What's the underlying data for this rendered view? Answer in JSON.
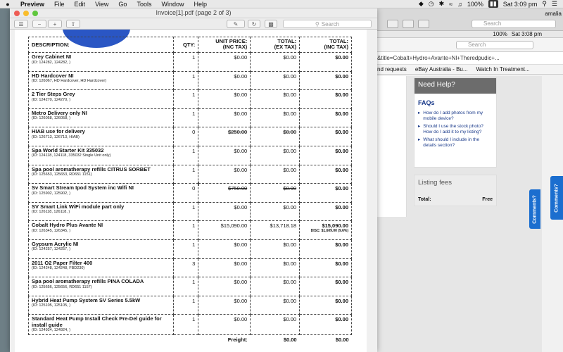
{
  "menubar": {
    "app": "Preview",
    "items": [
      "File",
      "Edit",
      "View",
      "Go",
      "Tools",
      "Window",
      "Help"
    ],
    "battery": "100%",
    "clock": "Sat 3:09 pm",
    "user": "amalia"
  },
  "preview": {
    "title": "Invoice[1].pdf (page 2 of 3)",
    "search_placeholder": "Search"
  },
  "browser": {
    "search_placeholder": "Search",
    "inner_battery": "100%",
    "inner_clock": "Sat 3:08 pm",
    "inner_user": "amalia",
    "url": "&title=Cobalt+Hydro+Avante+Nl+Theredpudic+...",
    "bookmarks": [
      "nd requests",
      "eBay Australia - Bu...",
      "Watch In Treatment..."
    ],
    "help": {
      "title": "Need Help?",
      "faqs_title": "FAQs",
      "questions": [
        "How do I add photos from my mobile device?",
        "Should I use the stock photo? How do I add it to my listing?",
        "What should I include in the details section?"
      ]
    },
    "fees": {
      "title": "Listing fees",
      "total_label": "Total:",
      "total_value": "Free"
    },
    "comments_label": "Comments?"
  },
  "invoice": {
    "headers": {
      "desc": "DESCRIPTION:",
      "qty": "QTY:",
      "unit_price": "UNIT PRICE:",
      "unit_price_sub": "(INC TAX)",
      "total_ex": "TOTAL:",
      "total_ex_sub": "(EX TAX)",
      "total_inc": "TOTAL:",
      "total_inc_sub": "(INC TAX)"
    },
    "rows": [
      {
        "name": "Grey Cabinet NI",
        "id": "(ID: 124282, 124282, )",
        "qty": "1",
        "unit": "$0.00",
        "ex": "$0.00",
        "inc": "$0.00",
        "strike": false,
        "disc": ""
      },
      {
        "name": "HD Hardcover NI",
        "id": "(ID: 126067, HD Hardcover, HD Hardcover)",
        "qty": "1",
        "unit": "$0.00",
        "ex": "$0.00",
        "inc": "$0.00",
        "strike": false,
        "disc": ""
      },
      {
        "name": "2 Tier Steps Grey",
        "id": "(ID: 124270, 124270, )",
        "qty": "1",
        "unit": "$0.00",
        "ex": "$0.00",
        "inc": "$0.00",
        "strike": false,
        "disc": ""
      },
      {
        "name": "Metro Delivery only NI",
        "id": "(ID: 126058, 126058, )",
        "qty": "1",
        "unit": "$0.00",
        "ex": "$0.00",
        "inc": "$0.00",
        "strike": false,
        "disc": ""
      },
      {
        "name": "HIAB use for delivery",
        "id": "(ID: 126713, 126713, HIAB)",
        "qty": "0",
        "unit": "$250.00",
        "ex": "$0.00",
        "inc": "$0.00",
        "strike": true,
        "disc": ""
      },
      {
        "name": "Spa World Starter Kit 335032",
        "id": "(ID: 124118, 124118, 335032 Single Unit only)",
        "qty": "1",
        "unit": "$0.00",
        "ex": "$0.00",
        "inc": "$0.00",
        "strike": false,
        "disc": ""
      },
      {
        "name": "Spa pool aromatherapy refills CITRUS SORBET",
        "id": "(ID: 125653, 125653, RD651 1151)",
        "qty": "1",
        "unit": "$0.00",
        "ex": "$0.00",
        "inc": "$0.00",
        "strike": false,
        "disc": ""
      },
      {
        "name": "Sv Smart Stream Ipod System inc Wifi NI",
        "id": "(ID: 125902, 125902, )",
        "qty": "0",
        "unit": "$750.00",
        "ex": "$0.00",
        "inc": "$0.00",
        "strike": true,
        "disc": ""
      },
      {
        "name": "SV Smart Link WiFi module part only",
        "id": "(ID: 126118, 126118, )",
        "qty": "1",
        "unit": "$0.00",
        "ex": "$0.00",
        "inc": "$0.00",
        "strike": false,
        "disc": ""
      },
      {
        "name": "Cobalt Hydro Plus Avante NI",
        "id": "(ID: 126345, 126345, )",
        "qty": "1",
        "unit": "$15,090.00",
        "ex": "$13,718.18",
        "inc": "$15,090.00",
        "strike": false,
        "disc": "DISC: $1,609.00 (9.6%)"
      },
      {
        "name": "Gypsum Acrylic NI",
        "id": "(ID: 124257, 124257, )",
        "qty": "1",
        "unit": "$0.00",
        "ex": "$0.00",
        "inc": "$0.00",
        "strike": false,
        "disc": ""
      },
      {
        "name": "2011 O2 Paper Filter 400",
        "id": "(ID: 124248, 124248, FBD230)",
        "qty": "3",
        "unit": "$0.00",
        "ex": "$0.00",
        "inc": "$0.00",
        "strike": false,
        "disc": ""
      },
      {
        "name": "Spa pool aromatherapy refills PINA COLADA",
        "id": "(ID: 125656, 125656, RD651 1157)",
        "qty": "1",
        "unit": "$0.00",
        "ex": "$0.00",
        "inc": "$0.00",
        "strike": false,
        "disc": ""
      },
      {
        "name": "Hybrid Heat Pump System SV Series 5.5kW",
        "id": "(ID: 125105, 125105, )",
        "qty": "1",
        "unit": "$0.00",
        "ex": "$0.00",
        "inc": "$0.00",
        "strike": false,
        "disc": ""
      },
      {
        "name": "Standard Heat Pump Install Check Pre-Del guide for install guide",
        "id": "(ID: 124924, 124924, )",
        "qty": "1",
        "unit": "$0.00",
        "ex": "$0.00",
        "inc": "$0.00",
        "strike": false,
        "disc": ""
      }
    ],
    "freight": {
      "label": "Freight:",
      "ex": "$0.00",
      "inc": "$0.00"
    }
  }
}
